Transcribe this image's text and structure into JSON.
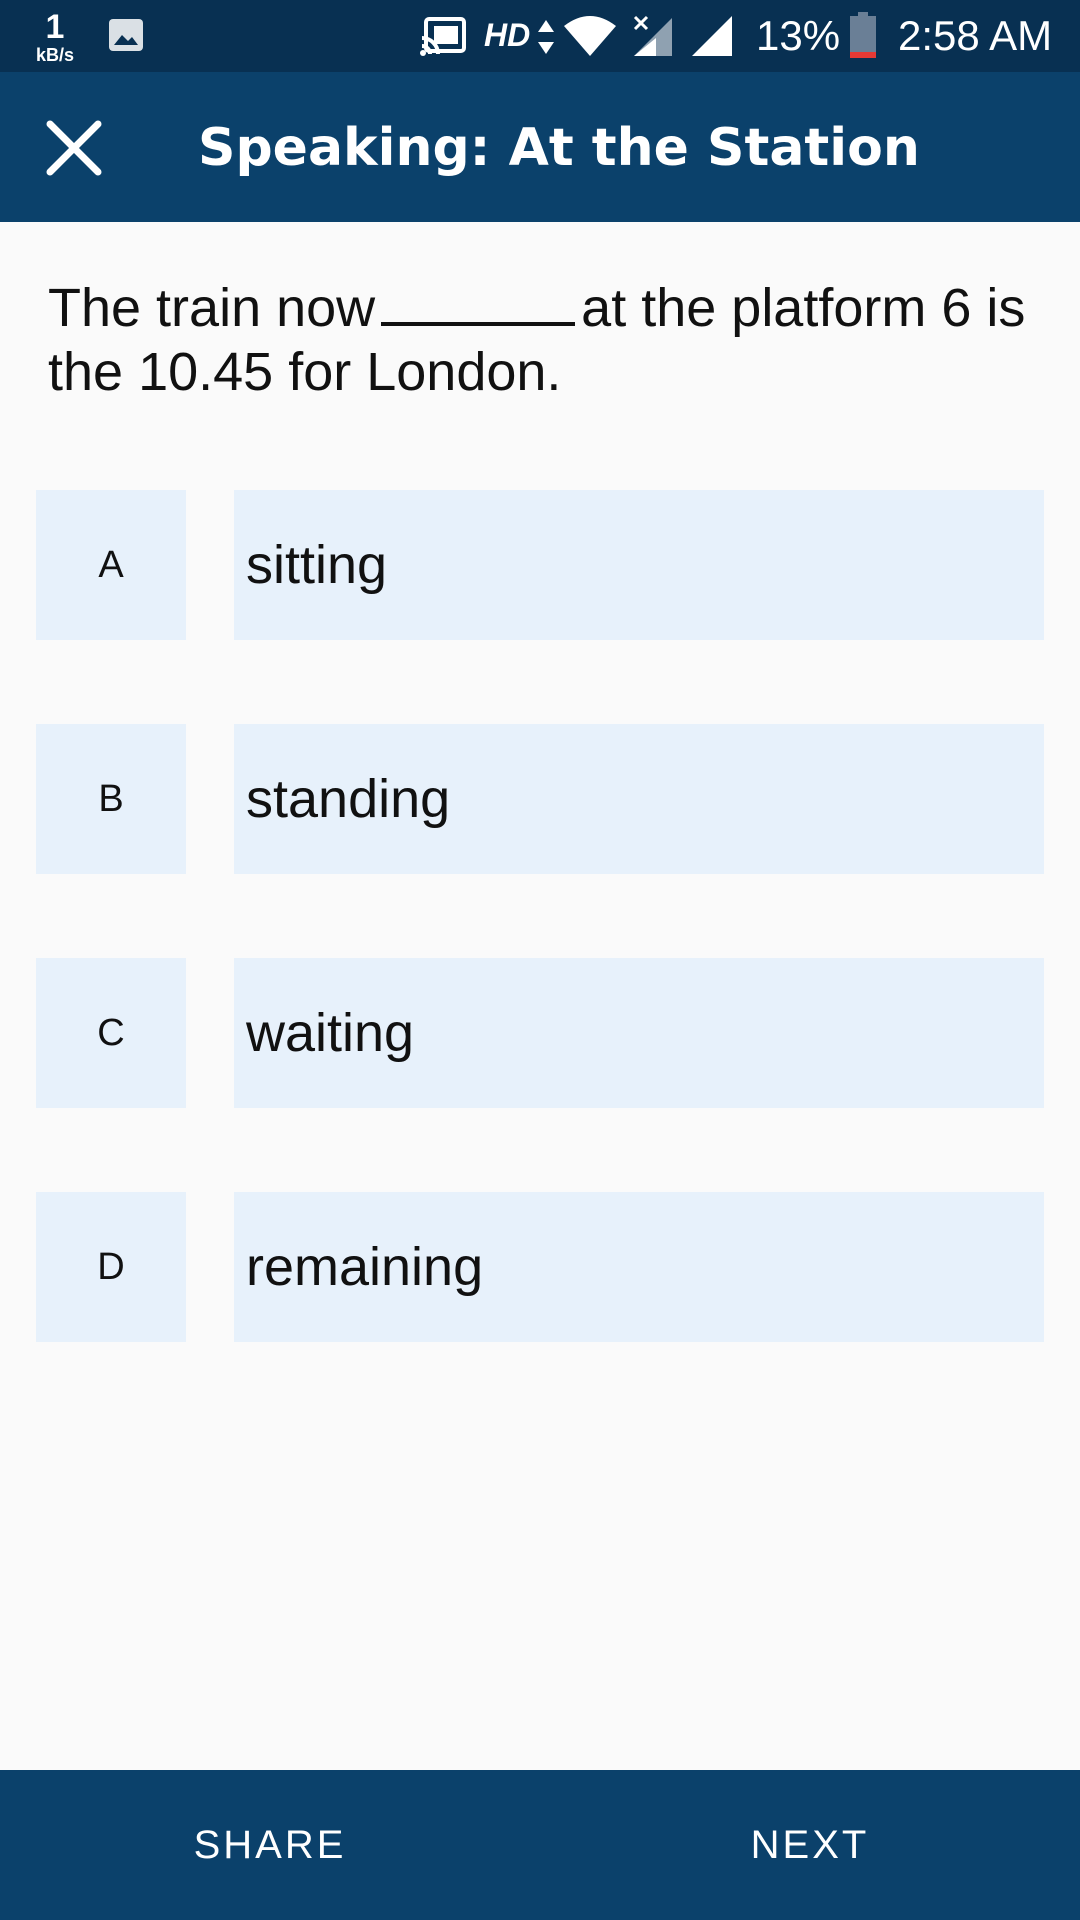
{
  "status_bar": {
    "net_speed_value": "1",
    "net_speed_unit": "kB/s",
    "hd_label": "HD",
    "battery_percent": "13%",
    "time": "2:58 AM",
    "icons": [
      "image-icon",
      "cast-icon",
      "data-arrows-icon",
      "wifi-icon",
      "signal-no-service-icon",
      "signal-icon",
      "battery-low-icon"
    ]
  },
  "app_bar": {
    "title": "Speaking: At the Station",
    "close_icon": "close-icon"
  },
  "question": {
    "part1": "The train now",
    "part2": "at the platform 6 is the 10.45 for London."
  },
  "options": [
    {
      "letter": "A",
      "text": "sitting"
    },
    {
      "letter": "B",
      "text": "standing"
    },
    {
      "letter": "C",
      "text": "waiting"
    },
    {
      "letter": "D",
      "text": "remaining"
    }
  ],
  "bottom_bar": {
    "share_label": "SHARE",
    "next_label": "NEXT"
  },
  "colors": {
    "status_bar": "#083052",
    "app_bar": "#0b416b",
    "option_bg": "#e7f1fb",
    "page_bg": "#fafafa",
    "battery_low": "#e53935"
  }
}
